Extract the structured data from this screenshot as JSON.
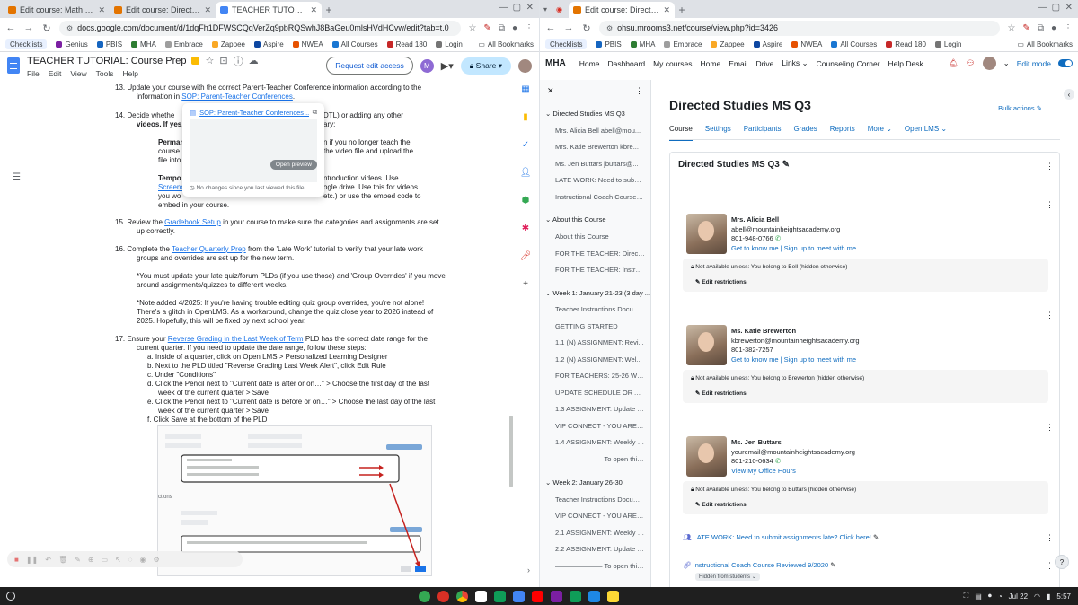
{
  "left_window": {
    "tabs": [
      {
        "title": "Edit course: Math Essential Ele",
        "color": "#e37400"
      },
      {
        "title": "Edit course: Directed Studies M",
        "color": "#e37400"
      },
      {
        "title": "TEACHER TUTORIAL: Course Pr",
        "color": "#4285f4",
        "active": true
      }
    ],
    "url": "docs.google.com/document/d/1dqFh1DFWSCQqVerZq9pbRQSwhJ8BaGeu0mlsHVdHCvw/edit?tab=t.0",
    "bookmarks": [
      "Checklists",
      "Genius",
      "PBIS",
      "MHA",
      "Embrace",
      "Zappee",
      "Aspire",
      "NWEA",
      "All Courses",
      "Read 180",
      "Login"
    ],
    "all_bookmarks": "All Bookmarks",
    "doc_title": "TEACHER TUTORIAL: Course Prep",
    "menu": [
      "File",
      "Edit",
      "View",
      "Tools",
      "Help"
    ],
    "request_edit": "Request edit access",
    "share": "Share",
    "avatar_letter": "M"
  },
  "doc": {
    "l13a": "13.  Update your course with the correct Parent-Teacher Conference information according to the",
    "l13b_pre": "information in ",
    "l13b_link": "SOP: Parent-Teacher Conferences",
    "l13b_post": ".",
    "l14a_pre": "14.  Decide whethe",
    "l14a_post": "DTL) or adding any other",
    "l14b_pre": "videos. If yes, t",
    "l14b_post": "ary:",
    "l14c_pre": "Perman",
    "l14c_post": "n if you no longer teach the",
    "l14d_pre": "course.",
    "l14d_post": "the video file and upload the",
    "l14e": "file into",
    "l14f_pre": "Tempo",
    "l14f_post": "ntroduction videos. Use",
    "l14g_pre": "Screenc",
    "l14g_post": "ogle drive. Use this for videos",
    "l14h_pre": "you wo",
    "l14h_post": "etc.) or use the embed code to",
    "l14i": "embed in your course.",
    "l15_pre": "15.  Review the ",
    "l15_link": "Gradebook Setup",
    "l15_post": " in your course to make sure the categories and assignments are set",
    "l15b": "up correctly.",
    "l16_pre": "16.  Complete the ",
    "l16_link": "Teacher Quarterly Prep",
    "l16_post": " from the 'Late Work' tutorial to verify that your late work",
    "l16b": "groups and overrides are set up for the new term.",
    "n1a": "*You must update your late quiz/forum PLDs (if you use those) and 'Group Overrides' if you move",
    "n1b": "around assignments/quizzes to different weeks.",
    "n2a": "*Note added 4/2025: If you're having trouble editing quiz group overrides, you're not alone!",
    "n2b": "There's a glitch in OpenLMS. As a workaround, change the quiz close year to 2026 instead of",
    "n2c": "2025. Hopefully, this will be fixed by next school year.",
    "l17_pre": "17.  Ensure your ",
    "l17_link": "Reverse Grading in the Last Week of Term",
    "l17_post": " PLD has the correct date range for the",
    "l17b": "current quarter. If you need to update the date range, follow these steps:",
    "sa": "a.   Inside of a quarter, click on Open LMS > Personalized Learning Designer",
    "sb": "b.   Next to the PLD titled \"Reverse Grading Last Week Alert\", click Edit Rule",
    "sc": "c.   Under \"Conditions\"",
    "sd1": "d.   Click the Pencil next to \"Current date is after or on…\" > Choose the first day of the last",
    "sd2": "week of the current quarter > Save",
    "se1": "e.   Click the Pencil next to \"Current date is before or on…\" > Choose the last day of the last",
    "se2": "week of the current quarter > Save",
    "sf": "f.    Click Save at the bottom of the PLD",
    "popup_title": "SOP: Parent-Teacher Conferences ...",
    "popup_btn": "Open preview",
    "popup_note": "No changes since you last viewed this file",
    "img_label": "ctions"
  },
  "right_window": {
    "tab_title": "Edit course: Directed Studies M",
    "url": "ohsu.mrooms3.net/course/view.php?id=3426",
    "bookmarks": [
      "Checklists",
      "PBIS",
      "MHA",
      "Embrace",
      "Zappee",
      "Aspire",
      "NWEA",
      "All Courses",
      "Read 180",
      "Login"
    ],
    "all_bookmarks": "All Bookmarks",
    "brand": "MHA",
    "nav": [
      "Home",
      "Dashboard",
      "My courses",
      "Home",
      "Email",
      "Drive",
      "Links",
      "Counseling Corner",
      "Help Desk"
    ],
    "edit_mode": "Edit mode",
    "sidebar": {
      "course": "Directed Studies MS Q3",
      "items1": [
        "Mrs. Alicia Bell abell@mou...",
        "Mrs. Katie Brewerton kbre...",
        "Ms. Jen Buttars jbuttars@...",
        "LATE WORK: Need to submit a...",
        "Instructional Coach Course Re..."
      ],
      "about": "About this Course",
      "items2": [
        "About this Course",
        "FOR THE TEACHER: Directed S...",
        "FOR THE TEACHER: Instructio..."
      ],
      "week1": "Week 1: January 21-23 (3 day ...",
      "items3": [
        "Teacher Instructions Docume...",
        "GETTING STARTED",
        "1.1 (N) ASSIGNMENT: Revi...",
        "1.2 (N) ASSIGNMENT: Wel...",
        "FOR TEACHERS: 25-26 Welco...",
        "UPDATE SCHEDULE OR ASSIG...",
        "1.3 ASSIGNMENT: Update Sch...",
        "VIP CONNECT - YOU ARE A VE...",
        "1.4 ASSIGNMENT: Weekly VIP ...",
        "——————— To open this w..."
      ],
      "week2": "Week 2: January 26-30",
      "items4": [
        "Teacher Instructions Docume...",
        "VIP CONNECT - YOU ARE A VE...",
        "2.1 ASSIGNMENT: Weekly VIP ...",
        "2.2 ASSIGNMENT: Update you...",
        "——————— To open this w..."
      ]
    },
    "page_title": "Directed Studies MS Q3",
    "bulk_actions": "Bulk actions",
    "course_tabs": [
      "Course",
      "Settings",
      "Participants",
      "Grades",
      "Reports",
      "More",
      "Open LMS"
    ],
    "section_title": "Directed Studies MS Q3",
    "teachers": [
      {
        "name": "Mrs. Alicia Bell",
        "email": "abell@mountainheightsacademy.org",
        "phone": "801-948-0766",
        "links": "Get to know me  |  Sign up to meet with me",
        "restrict": "Not available unless: You belong to Bell (hidden otherwise)"
      },
      {
        "name": "Ms. Katie Brewerton",
        "email": "kbrewerton@mountainheightsacademy.org",
        "phone": "801-382-7257",
        "links": "Get to know me  |  Sign up to meet with me",
        "restrict": "Not available unless: You belong to Brewerton (hidden otherwise)"
      },
      {
        "name": "Ms. Jen Buttars",
        "email": "youremail@mountainheightsacademy.org",
        "phone": "801-210-0634",
        "links": "View My Office Hours",
        "restrict": "Not available unless: You belong to Buttars (hidden otherwise)"
      }
    ],
    "edit_restrictions": "Edit restrictions",
    "late_work": "LATE WORK: Need to submit assignments late? Click here!",
    "coach": "Instructional Coach Course Reviewed 9/2020",
    "hidden_badge": "Hidden from students"
  },
  "tray": {
    "date": "Jul 22",
    "time": "5:57"
  }
}
